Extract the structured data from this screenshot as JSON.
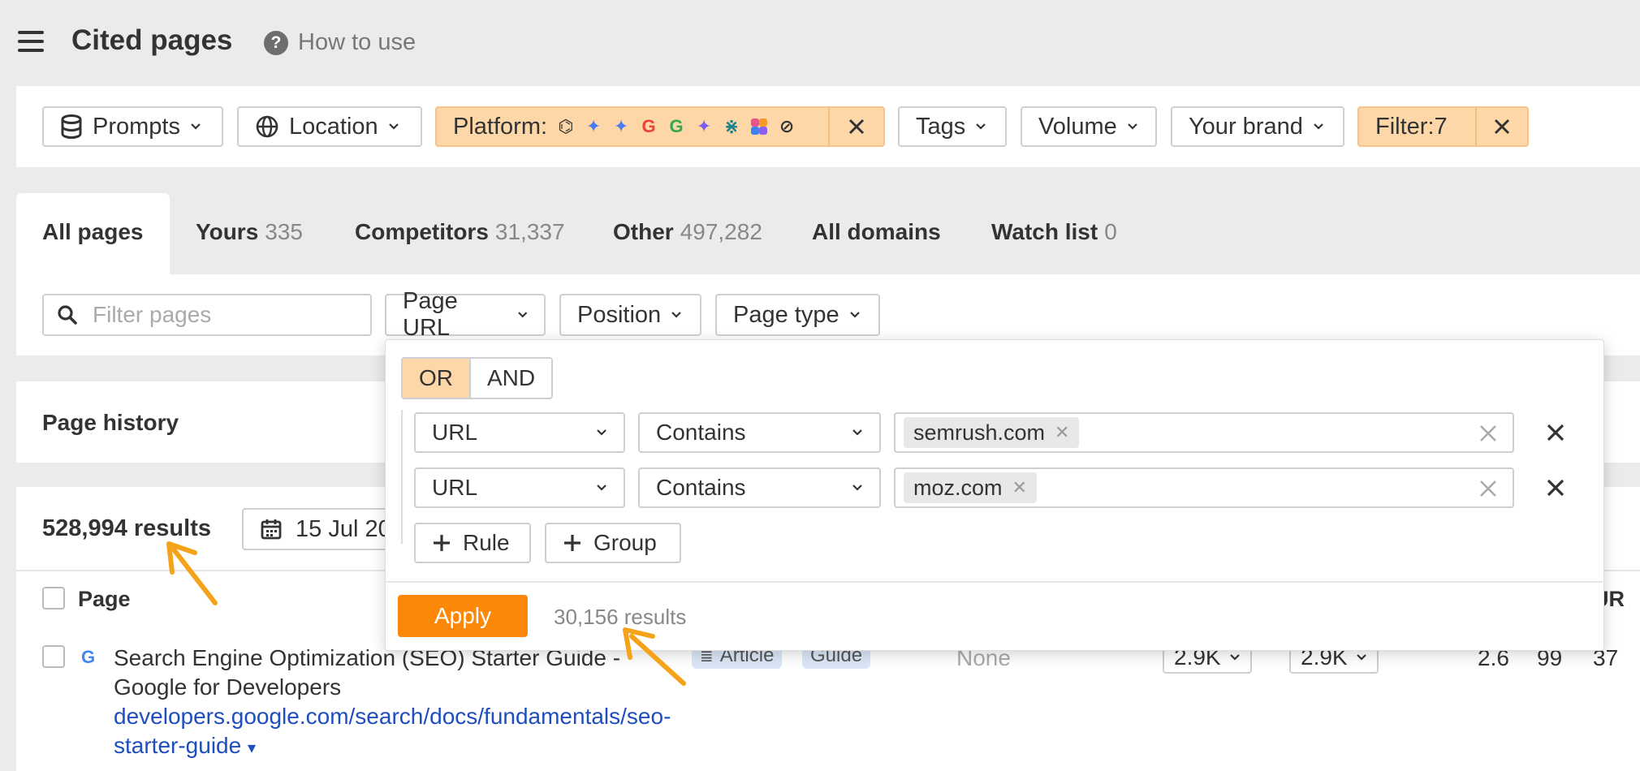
{
  "header": {
    "title": "Cited pages",
    "help_label": "How to use"
  },
  "filters": {
    "prompts": "Prompts",
    "location": "Location",
    "platform_label": "Platform:",
    "tags": "Tags",
    "volume": "Volume",
    "your_brand": "Your brand",
    "filter_count": "Filter:7"
  },
  "tabs": [
    {
      "label": "All pages",
      "count": ""
    },
    {
      "label": "Yours",
      "count": "335"
    },
    {
      "label": "Competitors",
      "count": "31,337"
    },
    {
      "label": "Other",
      "count": "497,282"
    },
    {
      "label": "All domains",
      "count": ""
    },
    {
      "label": "Watch list",
      "count": "0"
    }
  ],
  "filter_row": {
    "search_placeholder": "Filter pages",
    "page_url": "Page URL",
    "position": "Position",
    "page_type": "Page type"
  },
  "history": {
    "title": "Page history"
  },
  "results": {
    "count": "528,994 results",
    "date": "15 Jul 20",
    "col_page": "Page",
    "col_ur": "UR",
    "row": {
      "title": "Search Engine Optimization (SEO) Starter Guide - Google for Developers",
      "url": "developers.google.com/search/docs/fundamentals/seo-starter-guide",
      "tag1": "Article",
      "tag2": "Guide",
      "position": "None",
      "vol1": "2.9K",
      "vol2": "2.9K",
      "n1": "2.6",
      "n2": "99",
      "n3": "37"
    }
  },
  "popup": {
    "or_label": "OR",
    "and_label": "AND",
    "rules": [
      {
        "field": "URL",
        "operator": "Contains",
        "value": "semrush.com"
      },
      {
        "field": "URL",
        "operator": "Contains",
        "value": "moz.com"
      }
    ],
    "add_rule": "Rule",
    "add_group": "Group",
    "apply": "Apply",
    "apply_count": "30,156 results"
  },
  "colors": {
    "accent_orange": "#fd8708",
    "filter_highlight": "#fdd7a8",
    "link_blue": "#1e4dbf",
    "annotation_arrow": "#f5a31a"
  }
}
